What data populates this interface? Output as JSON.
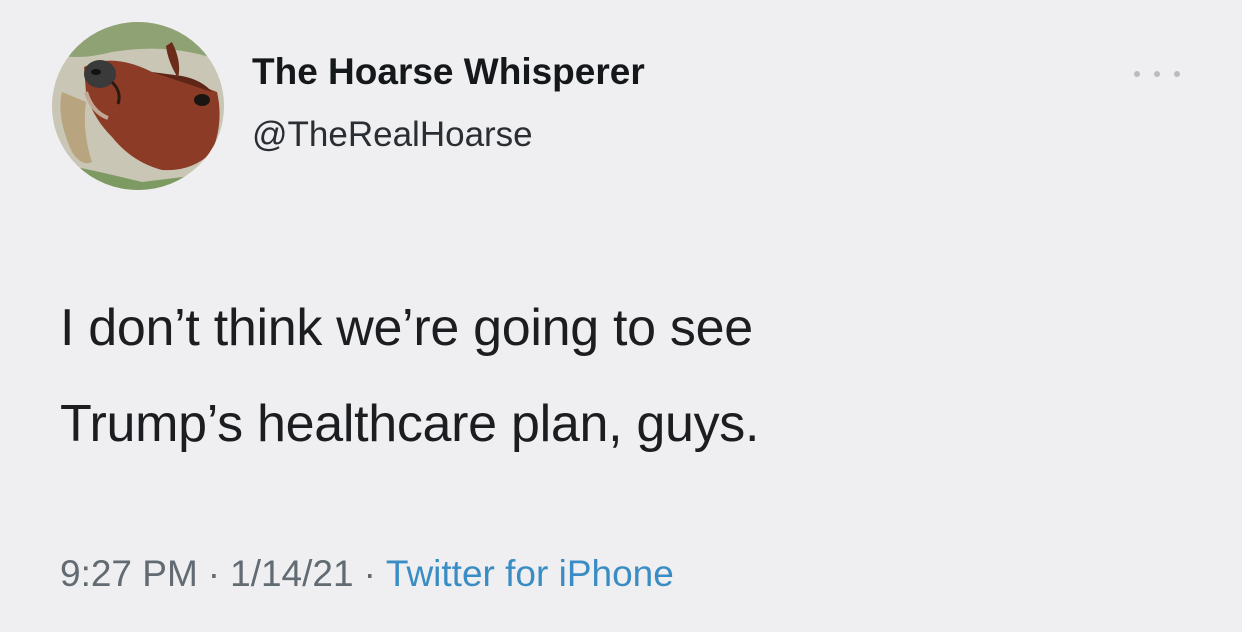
{
  "tweet": {
    "author": {
      "display_name": "The Hoarse Whisperer",
      "handle": "@TheRealHoarse",
      "avatar_icon": "horse-avatar"
    },
    "more_icon": "more-options-icon",
    "text_lines": [
      "I don’t think we’re going to see",
      "Trump’s healthcare plan, guys."
    ],
    "time": "9:27 PM",
    "separator": "·",
    "date": "1/14/21",
    "source": "Twitter for iPhone",
    "colors": {
      "background": "#efeff1",
      "text": "#1b1d20",
      "meta": "#626a72",
      "link": "#3a8dc4"
    }
  }
}
